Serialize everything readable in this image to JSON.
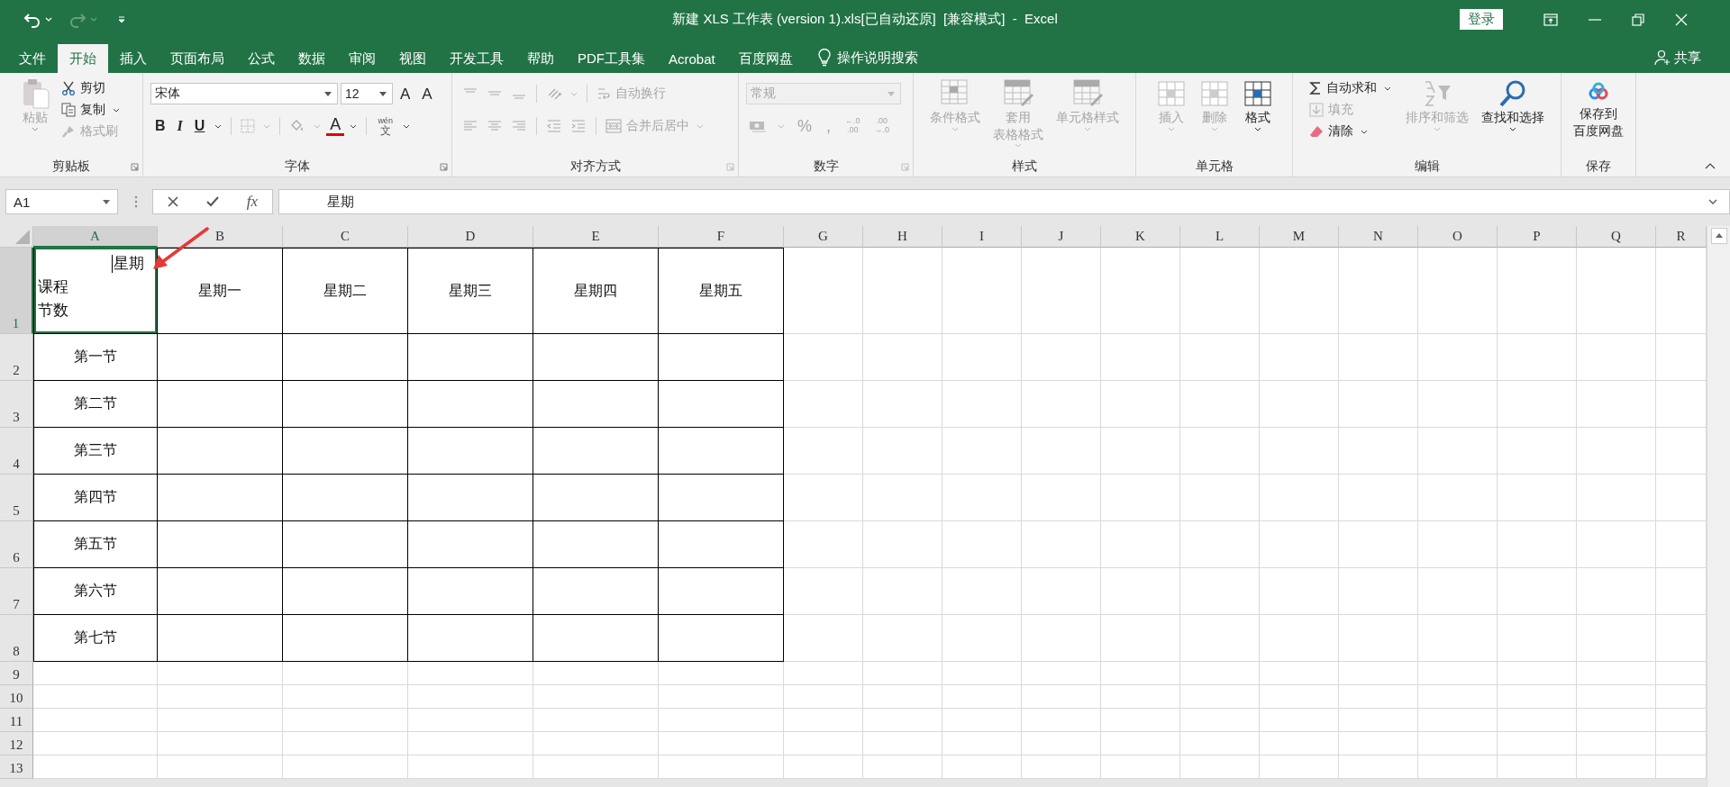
{
  "title_bar": {
    "title": "新建 XLS 工作表 (version 1).xls[已自动还原]  [兼容模式]  -  Excel",
    "login": "登录"
  },
  "menu_tabs": [
    {
      "label": "文件",
      "selected": false
    },
    {
      "label": "开始",
      "selected": true
    },
    {
      "label": "插入",
      "selected": false
    },
    {
      "label": "页面布局",
      "selected": false
    },
    {
      "label": "公式",
      "selected": false
    },
    {
      "label": "数据",
      "selected": false
    },
    {
      "label": "审阅",
      "selected": false
    },
    {
      "label": "视图",
      "selected": false
    },
    {
      "label": "开发工具",
      "selected": false
    },
    {
      "label": "帮助",
      "selected": false
    },
    {
      "label": "PDF工具集",
      "selected": false
    },
    {
      "label": "Acrobat",
      "selected": false
    },
    {
      "label": "百度网盘",
      "selected": false
    }
  ],
  "tell_me": "操作说明搜索",
  "share": "共享",
  "ribbon": {
    "clipboard": {
      "label": "剪贴板",
      "paste": {
        "label": "粘贴",
        "disabled": true
      },
      "cut": {
        "label": "剪切",
        "disabled": false
      },
      "copy": {
        "label": "复制",
        "disabled": false
      },
      "painter": {
        "label": "格式刷",
        "disabled": true
      }
    },
    "font": {
      "label": "字体",
      "font_name": "宋体",
      "font_size": "12",
      "grow": "A",
      "shrink": "A",
      "bold": "B",
      "italic": "I",
      "underline": "U",
      "font_color": "A",
      "pinyin": "wén",
      "phonetic": "文"
    },
    "alignment": {
      "label": "对齐方式",
      "wrap_text": {
        "label": "自动换行",
        "disabled": true
      },
      "merge": {
        "label": "合并后居中",
        "disabled": true
      }
    },
    "number": {
      "label": "数字",
      "format": {
        "label": "常规",
        "disabled": true
      },
      "percent": "%",
      "comma": ",",
      "increase_decimal": [
        "←.0",
        ".00"
      ],
      "decrease_decimal": [
        ".00",
        "→.0"
      ]
    },
    "styles": {
      "label": "样式",
      "items": [
        {
          "lines": [
            "条件格式"
          ],
          "disabled": true
        },
        {
          "lines": [
            "套用",
            "表格格式"
          ],
          "disabled": true
        },
        {
          "lines": [
            "单元格样式"
          ],
          "disabled": true
        }
      ]
    },
    "cells": {
      "label": "单元格",
      "items": [
        {
          "lines": [
            "插入"
          ],
          "disabled": true
        },
        {
          "lines": [
            "删除"
          ],
          "disabled": true
        },
        {
          "lines": [
            "格式"
          ],
          "disabled": false
        }
      ]
    },
    "editing": {
      "label": "编辑",
      "autosum": {
        "label": "自动求和",
        "disabled": false
      },
      "fill": {
        "label": "填充",
        "disabled": true
      },
      "clear": {
        "label": "清除",
        "disabled": false
      },
      "items": [
        {
          "lines": [
            "排序和筛选"
          ],
          "disabled": true
        },
        {
          "lines": [
            "查找和选择"
          ],
          "disabled": false
        }
      ]
    },
    "save": {
      "label": "保存",
      "items": [
        {
          "lines": [
            "保存到",
            "百度网盘"
          ],
          "disabled": false
        }
      ]
    }
  },
  "formula_bar": {
    "name_box": "A1",
    "fx": "fx",
    "content": "星期"
  },
  "sheet": {
    "columns": [
      {
        "label": "A",
        "selected": true
      },
      {
        "label": "B",
        "selected": false
      },
      {
        "label": "C",
        "selected": false
      },
      {
        "label": "D",
        "selected": false
      },
      {
        "label": "E",
        "selected": false
      },
      {
        "label": "F",
        "selected": false
      },
      {
        "label": "G",
        "selected": false
      },
      {
        "label": "H",
        "selected": false
      },
      {
        "label": "I",
        "selected": false
      },
      {
        "label": "J",
        "selected": false
      },
      {
        "label": "K",
        "selected": false
      },
      {
        "label": "L",
        "selected": false
      },
      {
        "label": "M",
        "selected": false
      },
      {
        "label": "N",
        "selected": false
      },
      {
        "label": "O",
        "selected": false
      },
      {
        "label": "P",
        "selected": false
      },
      {
        "label": "Q",
        "selected": false
      },
      {
        "label": "R",
        "selected": false
      }
    ],
    "rows": [
      {
        "label": "1",
        "selected": true
      },
      {
        "label": "2",
        "selected": false
      },
      {
        "label": "3",
        "selected": false
      },
      {
        "label": "4",
        "selected": false
      },
      {
        "label": "5",
        "selected": false
      },
      {
        "label": "6",
        "selected": false
      },
      {
        "label": "7",
        "selected": false
      },
      {
        "label": "8",
        "selected": false
      },
      {
        "label": "9",
        "selected": false
      },
      {
        "label": "10",
        "selected": false
      },
      {
        "label": "11",
        "selected": false
      },
      {
        "label": "12",
        "selected": false
      },
      {
        "label": "13",
        "selected": false
      }
    ],
    "corner_cell": {
      "top": "星期",
      "left_lines": [
        "课程",
        "节数"
      ],
      "editing": true
    },
    "day_headers": [
      "星期一",
      "星期二",
      "星期三",
      "星期四",
      "星期五"
    ],
    "period_labels": [
      "第一节",
      "第二节",
      "第三节",
      "第四节",
      "第五节",
      "第六节",
      "第七节"
    ]
  }
}
